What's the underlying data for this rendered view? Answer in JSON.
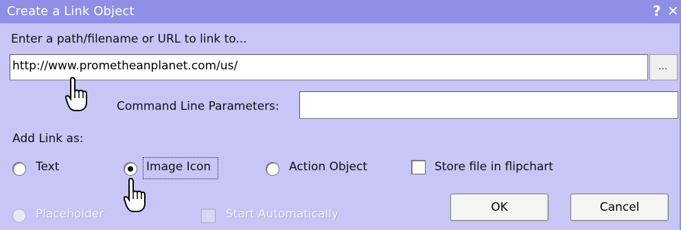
{
  "dialog": {
    "title": "Create a Link Object",
    "help_icon": "?",
    "close_icon": "✕"
  },
  "path": {
    "label": "Enter a path/filename or URL to link to...",
    "value": "http://www.prometheanplanet.com/us/",
    "browse_label": "..."
  },
  "command_line": {
    "label": "Command Line Parameters:",
    "value": ""
  },
  "link_as": {
    "label": "Add Link as:",
    "options": [
      {
        "label": "Text",
        "selected": false,
        "enabled": true
      },
      {
        "label": "Image Icon",
        "selected": true,
        "enabled": true
      },
      {
        "label": "Action Object",
        "selected": false,
        "enabled": true
      },
      {
        "label": "Placeholder",
        "selected": false,
        "enabled": false
      }
    ]
  },
  "store_file": {
    "label": "Store file in flipchart",
    "checked": false,
    "enabled": true
  },
  "start_auto": {
    "label": "Start Automatically",
    "checked": false,
    "enabled": false
  },
  "buttons": {
    "ok": "OK",
    "cancel": "Cancel"
  },
  "icons": {
    "cursor": "hand-pointer-icon"
  }
}
